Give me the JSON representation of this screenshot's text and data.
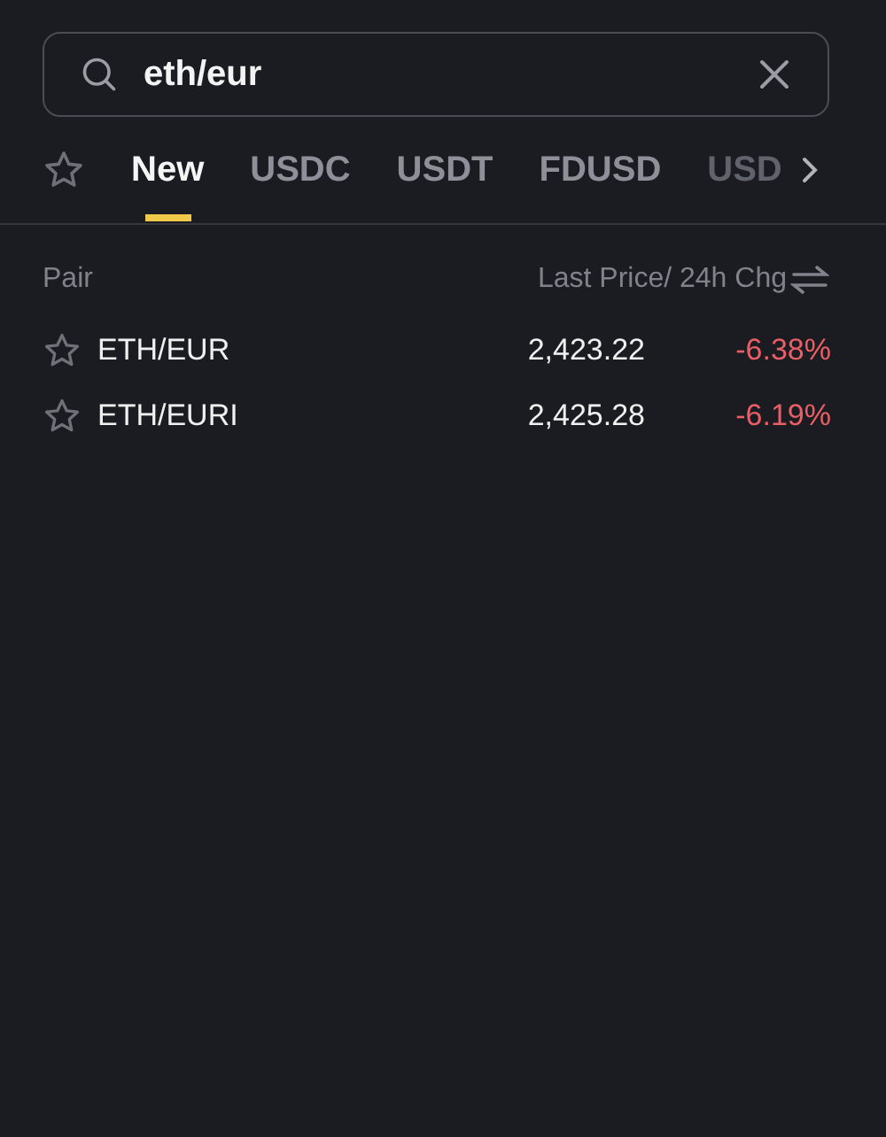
{
  "search": {
    "value": "eth/eur"
  },
  "tabs": [
    {
      "label": "New",
      "selected": true
    },
    {
      "label": "USDC",
      "selected": false
    },
    {
      "label": "USDT",
      "selected": false
    },
    {
      "label": "FDUSD",
      "selected": false
    },
    {
      "label": "USD",
      "selected": false,
      "cut": true
    }
  ],
  "table": {
    "columns": [
      "Pair",
      "Last Price/ 24h Chg"
    ],
    "rows": [
      {
        "pair": "ETH/EUR",
        "price": "2,423.22",
        "change": "-6.38%"
      },
      {
        "pair": "ETH/EURI",
        "price": "2,425.28",
        "change": "-6.19%"
      }
    ]
  }
}
